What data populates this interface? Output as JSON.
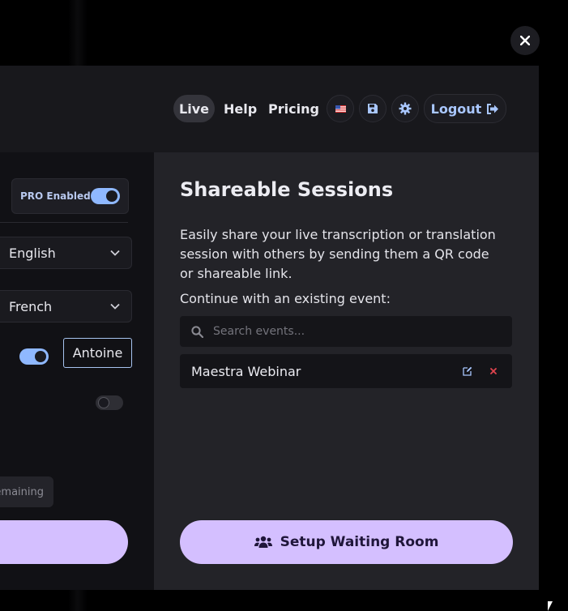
{
  "header": {
    "nav": {
      "live": "Live",
      "help": "Help",
      "pricing": "Pricing"
    },
    "logout_label": "Logout",
    "icons": [
      "us-flag-icon",
      "save-icon",
      "gear-icon",
      "logout-arrow-icon"
    ]
  },
  "left_panel": {
    "pro_label": "PRO Enabled",
    "pro_enabled": true,
    "source_language": "English",
    "target_language": "French",
    "speaker_name_enabled": true,
    "speaker_name": "Antoine",
    "secondary_toggle_enabled": false,
    "remaining_label": "emaining"
  },
  "shareable": {
    "title": "Shareable Sessions",
    "description": "Easily share your live transcription or translation session with others by sending them a QR code or shareable link.",
    "continue_label": "Continue with an existing event:",
    "search_placeholder": "Search events...",
    "events": [
      {
        "name": "Maestra Webinar"
      }
    ],
    "setup_button": "Setup Waiting Room"
  },
  "colors": {
    "accent": "#d4bfff",
    "toggle_on": "#8fb8ff",
    "link": "#a9c7ff",
    "delete": "#e0444e"
  }
}
